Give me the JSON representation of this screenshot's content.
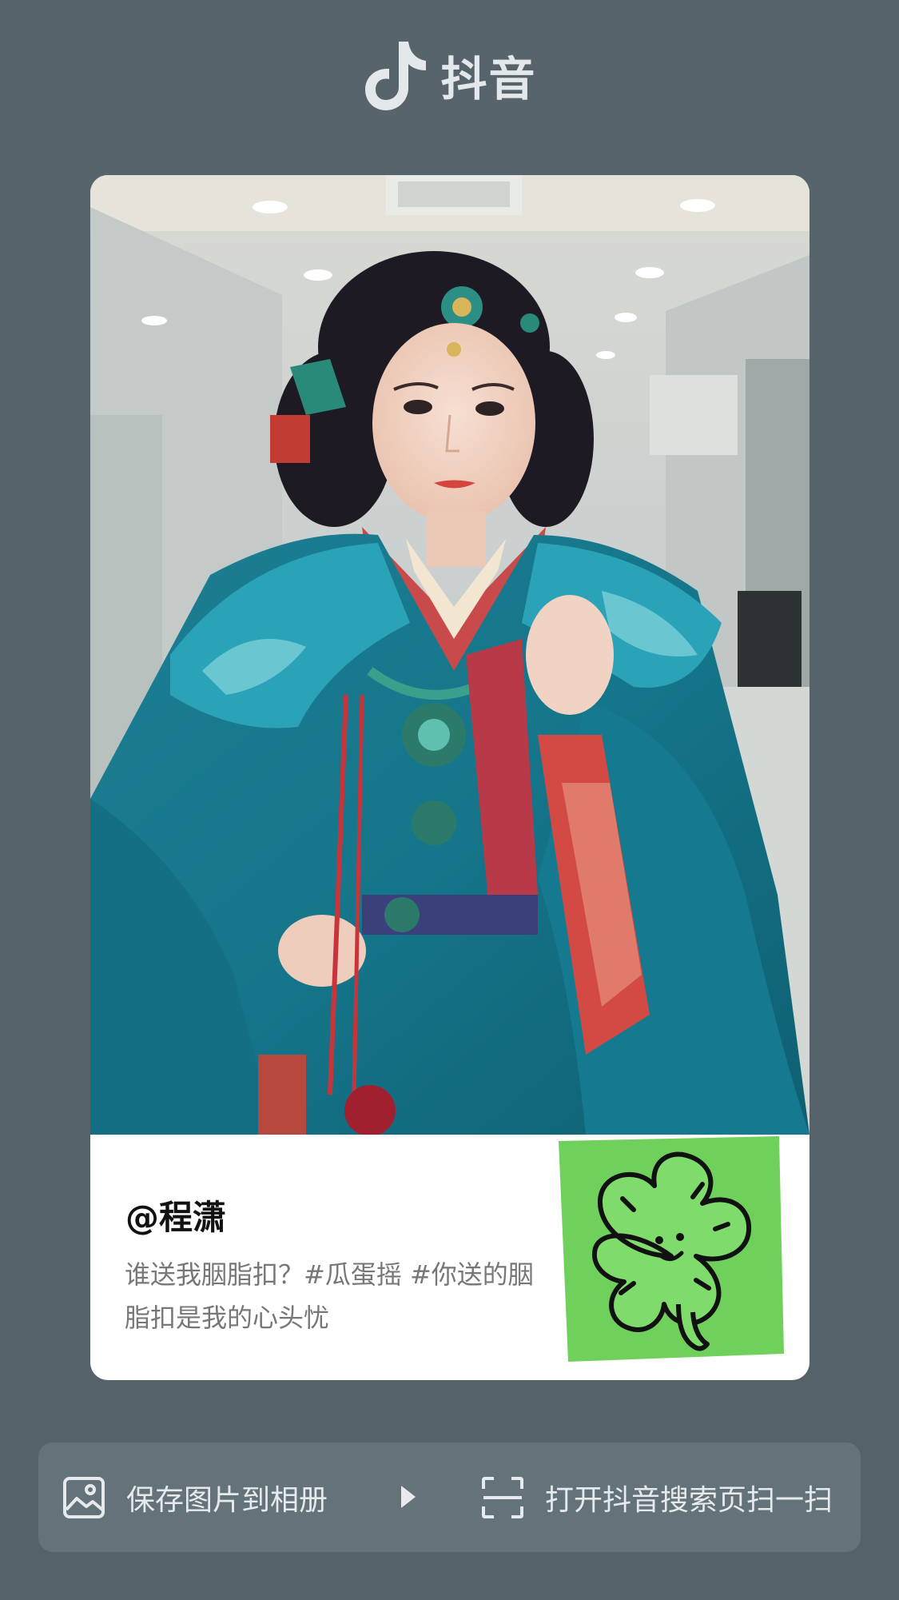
{
  "header": {
    "logo_icon": "tiktok-note-icon",
    "app_name": "抖音"
  },
  "card": {
    "author": "@程潇",
    "description": "谁送我胭脂扣？#瓜蛋摇 #你送的胭脂扣是我的心头忧",
    "photo_subject": "woman in teal hanfu with ornate headdress",
    "sticker": "green-clover-face-sticker",
    "sticker_color": "#6fd15c"
  },
  "actions": {
    "save_icon": "image-gallery-icon",
    "save_label": "保存图片到相册",
    "divider_icon": "play-arrow-icon",
    "scan_icon": "scan-frame-icon",
    "scan_label": "打开抖音搜索页扫一扫"
  },
  "colors": {
    "background": "#56636a",
    "action_bar": "#647279",
    "text_light": "#e6eaec"
  }
}
